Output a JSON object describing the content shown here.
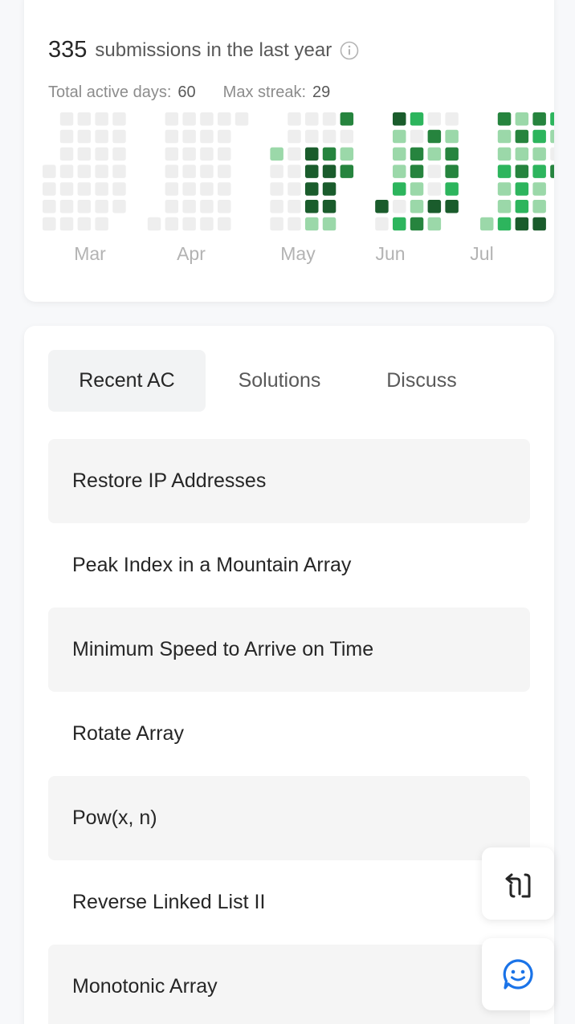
{
  "submissions": {
    "count": "335",
    "text": "submissions in the last year",
    "info_icon": "info-icon"
  },
  "stats": {
    "active_label": "Total active days:",
    "active_value": "60",
    "streak_label": "Max streak:",
    "streak_value": "29"
  },
  "heatmap": {
    "months": [
      "Mar",
      "Apr",
      "May",
      "Jun",
      "Jul"
    ],
    "levels_legend": [
      "empty",
      "light",
      "medium",
      "strong",
      "darkest"
    ],
    "colors": {
      "empty": "#eeeeee",
      "light": "#9bd8a9",
      "medium": "#2db55d",
      "strong": "#26843e",
      "darkest": "#1a5c2c"
    },
    "weeks": [
      [
        null,
        null,
        null,
        0,
        0,
        0,
        0
      ],
      [
        0,
        0,
        0,
        0,
        0,
        0,
        0
      ],
      [
        0,
        0,
        0,
        0,
        0,
        0,
        0
      ],
      [
        0,
        0,
        0,
        0,
        0,
        0,
        0
      ],
      [
        0,
        0,
        0,
        0,
        0,
        0,
        null
      ],
      [],
      [
        null,
        null,
        null,
        null,
        null,
        null,
        0
      ],
      [
        0,
        0,
        0,
        0,
        0,
        0,
        0
      ],
      [
        0,
        0,
        0,
        0,
        0,
        0,
        0
      ],
      [
        0,
        0,
        0,
        0,
        0,
        0,
        0
      ],
      [
        0,
        0,
        0,
        0,
        0,
        0,
        0
      ],
      [
        0,
        null,
        null,
        null,
        null,
        null,
        null
      ],
      [],
      [
        null,
        null,
        1,
        0,
        0,
        0,
        0
      ],
      [
        0,
        0,
        0,
        0,
        0,
        0,
        0
      ],
      [
        0,
        0,
        4,
        4,
        4,
        4,
        1
      ],
      [
        0,
        0,
        3,
        4,
        4,
        4,
        1
      ],
      [
        3,
        0,
        1,
        3,
        null,
        null,
        null
      ],
      [],
      [
        null,
        null,
        null,
        null,
        null,
        4,
        0
      ],
      [
        4,
        1,
        1,
        1,
        2,
        0,
        2
      ],
      [
        2,
        0,
        3,
        3,
        1,
        1,
        3
      ],
      [
        0,
        3,
        1,
        0,
        0,
        4,
        1
      ],
      [
        0,
        1,
        3,
        3,
        2,
        4,
        null
      ],
      [],
      [
        null,
        null,
        null,
        null,
        null,
        null,
        1
      ],
      [
        3,
        1,
        1,
        2,
        1,
        1,
        2
      ],
      [
        1,
        3,
        1,
        3,
        2,
        2,
        4
      ],
      [
        3,
        2,
        1,
        2,
        1,
        1,
        4
      ],
      [
        2,
        1,
        0,
        3,
        null,
        null,
        null
      ]
    ]
  },
  "tabs": [
    {
      "label": "Recent AC"
    },
    {
      "label": "Solutions"
    },
    {
      "label": "Discuss"
    }
  ],
  "recent": [
    {
      "title": "Restore IP Addresses"
    },
    {
      "title": "Peak Index in a Mountain Array"
    },
    {
      "title": "Minimum Speed to Arrive on Time"
    },
    {
      "title": "Rotate Array"
    },
    {
      "title": "Pow(x, n)"
    },
    {
      "title": "Reverse Linked List II"
    },
    {
      "title": "Monotonic Array"
    }
  ],
  "fabs": {
    "share_icon": "share-icon",
    "chat_icon": "chat-icon"
  }
}
